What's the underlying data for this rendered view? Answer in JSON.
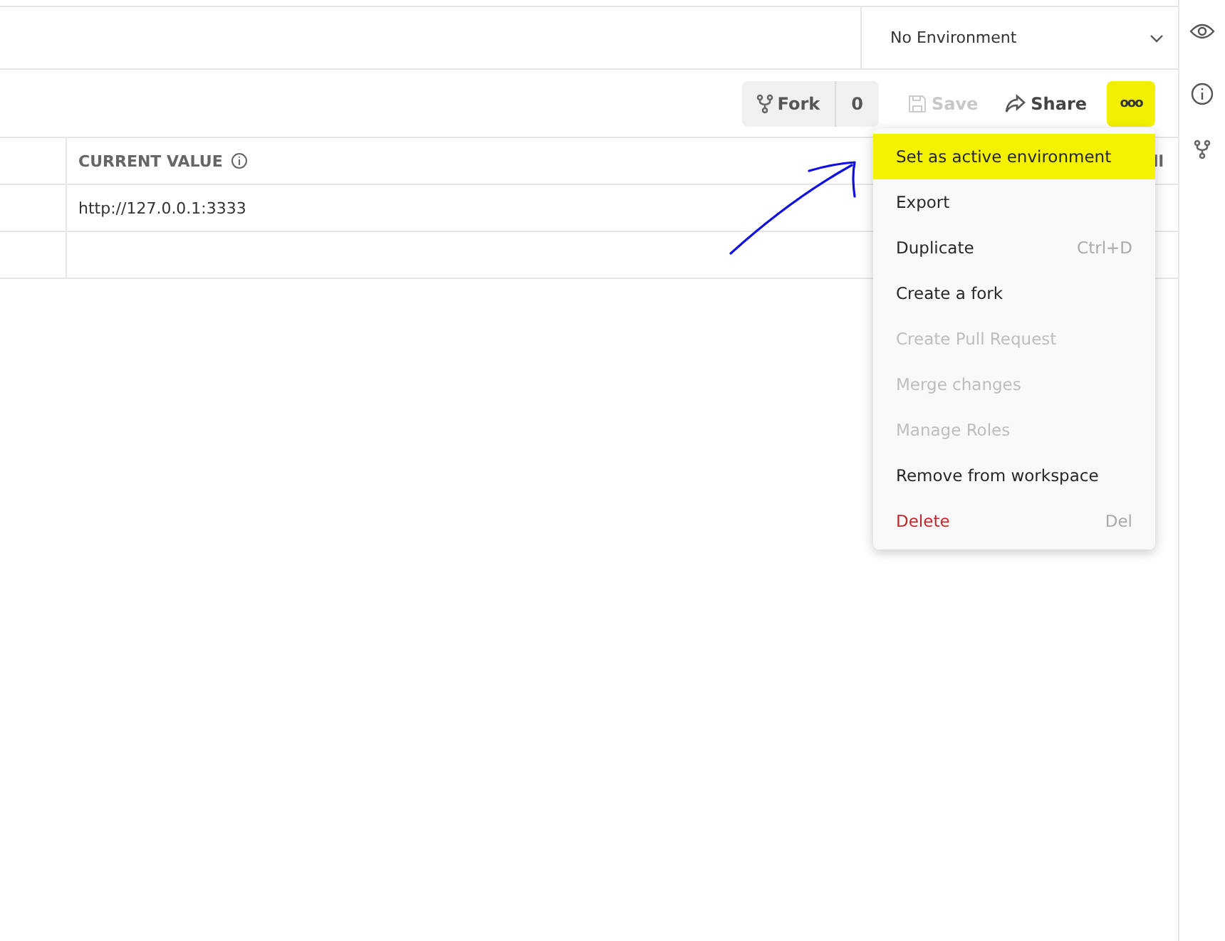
{
  "environment_selector": {
    "value": "No Environment"
  },
  "toolbar": {
    "fork": {
      "label": "Fork",
      "count": "0"
    },
    "save": {
      "label": "Save",
      "disabled": true
    },
    "share": {
      "label": "Share"
    },
    "more": {
      "label": "ooo",
      "highlighted": true
    }
  },
  "table": {
    "columns": [
      {
        "label": "CURRENT VALUE"
      }
    ],
    "column_3_header": "ll",
    "rows": [
      {
        "current_value": "http://127.0.0.1:3333"
      }
    ]
  },
  "menu": {
    "items": [
      {
        "label": "Set as active environment",
        "kind": "normal",
        "highlighted": true
      },
      {
        "label": "Export",
        "kind": "normal",
        "highlighted": false
      },
      {
        "label": "Duplicate",
        "shortcut": "Ctrl+D",
        "kind": "normal",
        "highlighted": false
      },
      {
        "label": "Create a fork",
        "kind": "normal",
        "highlighted": false
      },
      {
        "label": "Create Pull Request",
        "kind": "disabled",
        "highlighted": false
      },
      {
        "label": "Merge changes",
        "kind": "disabled",
        "highlighted": false
      },
      {
        "label": "Manage Roles",
        "kind": "disabled",
        "highlighted": false
      },
      {
        "label": "Remove from workspace",
        "kind": "normal",
        "highlighted": false
      },
      {
        "label": "Delete",
        "shortcut": "Del",
        "kind": "danger",
        "highlighted": false
      }
    ]
  }
}
